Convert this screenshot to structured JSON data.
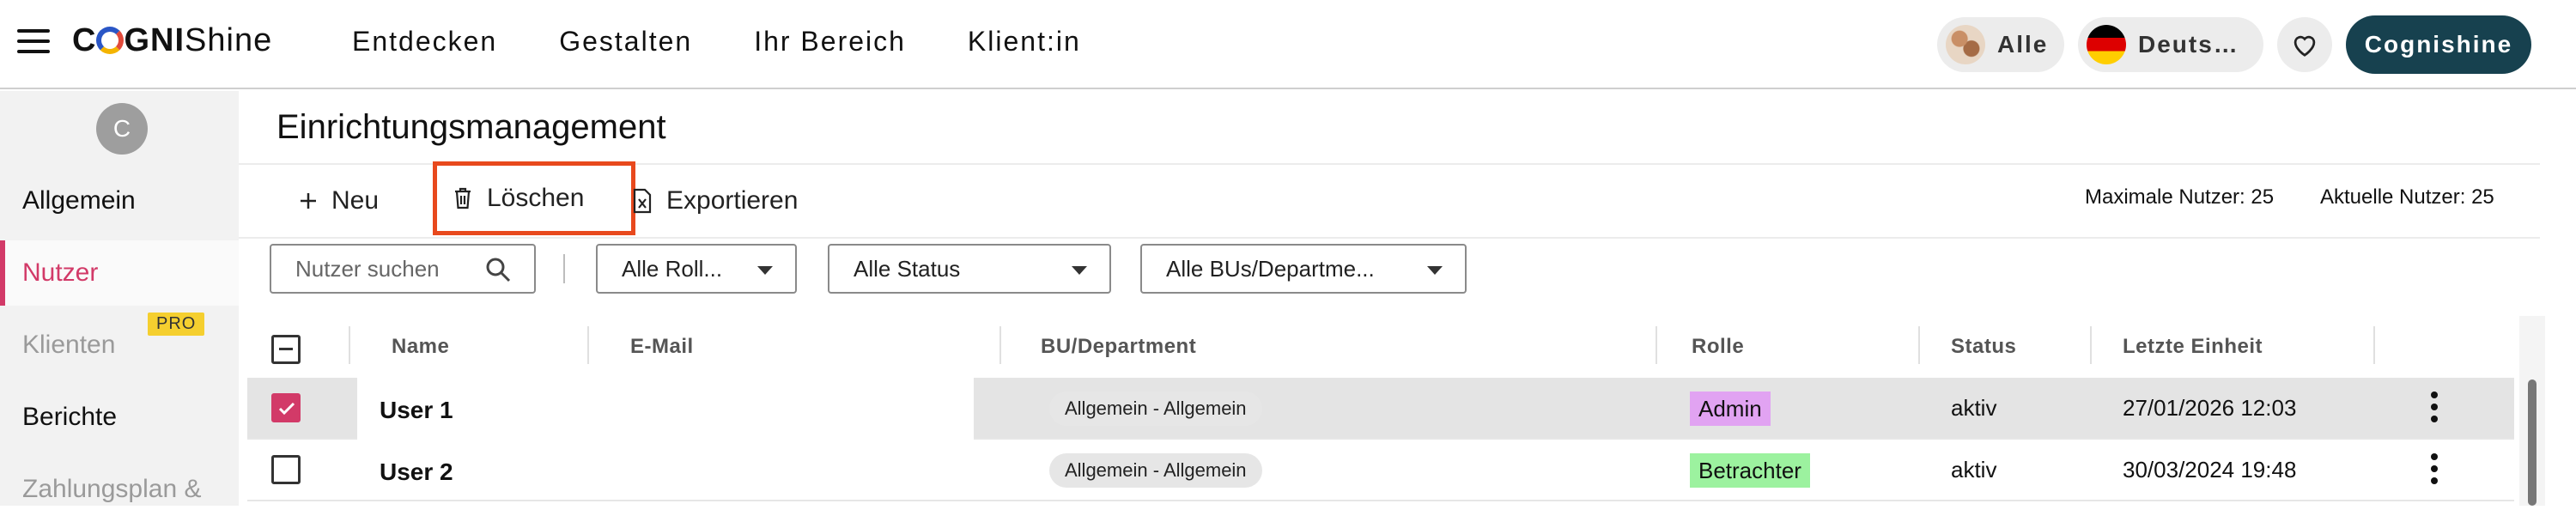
{
  "header": {
    "brand_bold": "C",
    "brand_bold2": "GNI",
    "brand_light": "Shine",
    "nav": [
      "Entdecken",
      "Gestalten",
      "Ihr Bereich",
      "Klient:in"
    ],
    "all_label": "Alle",
    "language_label": "Deuts…",
    "account_label": "Cognishine"
  },
  "sidebar": {
    "avatar_initial": "C",
    "items": [
      {
        "label": "Allgemein",
        "state": "normal"
      },
      {
        "label": "Nutzer",
        "state": "active"
      },
      {
        "label": "Klienten",
        "state": "disabled",
        "badge": "PRO"
      },
      {
        "label": "Berichte",
        "state": "normal"
      },
      {
        "label": "Zahlungsplan &",
        "state": "disabled"
      }
    ]
  },
  "main": {
    "title": "Einrichtungsmanagement",
    "toolbar": {
      "new_label": "Neu",
      "delete_label": "Löschen",
      "export_label": "Exportieren",
      "max_users": "Maximale Nutzer: 25",
      "current_users": "Aktuelle Nutzer: 25"
    },
    "filters": {
      "search_placeholder": "Nutzer suchen",
      "role": "Alle Roll...",
      "status": "Alle Status",
      "bu": "Alle BUs/Departme..."
    },
    "table": {
      "columns": [
        "Name",
        "E-Mail",
        "BU/Department",
        "Rolle",
        "Status",
        "Letzte Einheit"
      ],
      "rows": [
        {
          "name": "User 1",
          "email": "",
          "bu": "Allgemein - Allgemein",
          "role": "Admin",
          "status": "aktiv",
          "last": "27/01/2026 12:03",
          "checked": true
        },
        {
          "name": "User 2",
          "email": "",
          "bu": "Allgemein - Allgemein",
          "role": "Betrachter",
          "status": "aktiv",
          "last": "30/03/2024 19:48",
          "checked": false
        }
      ]
    }
  },
  "colors": {
    "accent": "#d23a68",
    "highlight_border": "#e8491d",
    "account_button": "#17414f",
    "admin_role": "#e1a3f2",
    "viewer_role": "#9cf29f"
  }
}
